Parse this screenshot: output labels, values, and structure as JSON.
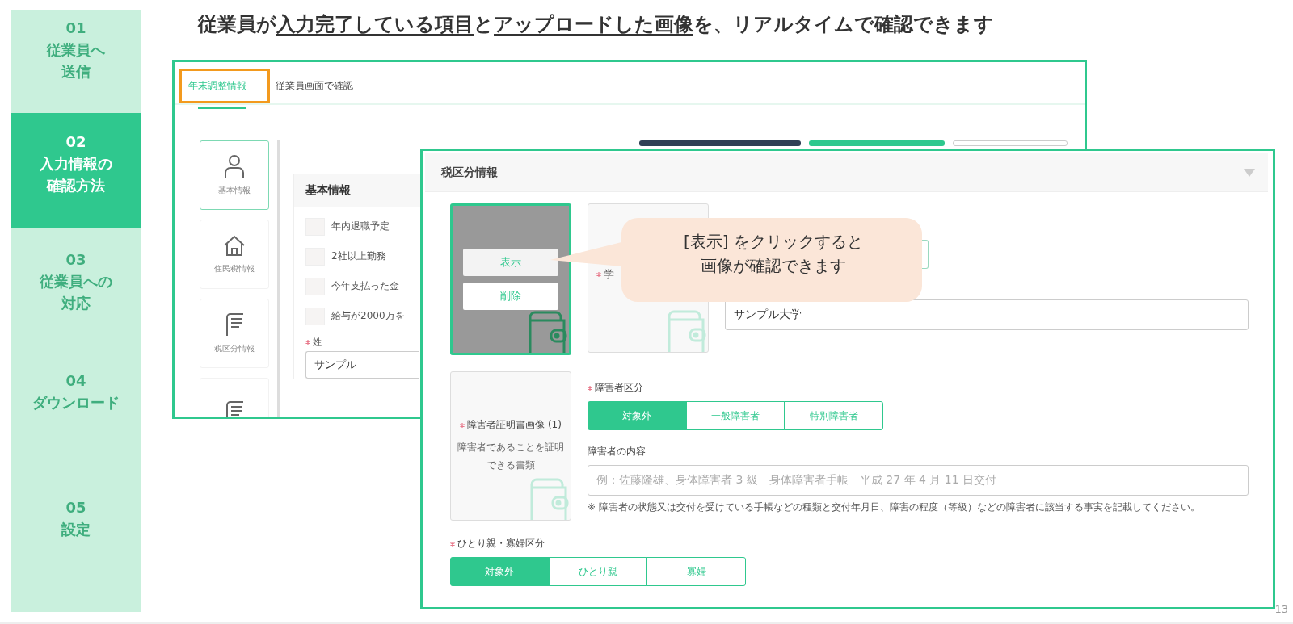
{
  "sidebar": {
    "steps": [
      {
        "number": "01",
        "lines": [
          "従業員へ",
          "送信"
        ],
        "selected": false
      },
      {
        "number": "02",
        "lines": [
          "入力情報の",
          "確認方法"
        ],
        "selected": true
      },
      {
        "number": "03",
        "lines": [
          "従業員への",
          "対応"
        ],
        "selected": false
      },
      {
        "number": "04",
        "lines": [
          "ダウンロード"
        ],
        "selected": false
      },
      {
        "number": "05",
        "lines": [
          "設定"
        ],
        "selected": false
      }
    ]
  },
  "headline": {
    "segments": [
      {
        "text": "従業員が",
        "underlined": false
      },
      {
        "text": "入力完了している項目",
        "underlined": true
      },
      {
        "text": "と",
        "underlined": false
      },
      {
        "text": "アップロードした画像",
        "underlined": true
      },
      {
        "text": "を、リアルタイムで確認できます",
        "underlined": false
      }
    ]
  },
  "screen_1": {
    "tabs": [
      {
        "label": "年末調整情報",
        "selected": true,
        "highlighted": true
      },
      {
        "label": "従業員画面で確認",
        "selected": false,
        "highlighted": false
      }
    ],
    "nav": [
      {
        "kind": "person",
        "label": "基本情報",
        "selected": true
      },
      {
        "kind": "house",
        "label": "住民税情報",
        "selected": false
      },
      {
        "kind": "document",
        "label": "税区分情報",
        "selected": false
      },
      {
        "kind": "document",
        "selected": false
      }
    ],
    "panel": {
      "title": "基本情報",
      "checkboxes": [
        {
          "label": "年内退職予定",
          "checked": false
        },
        {
          "label": "2社以上勤務",
          "checked": false
        },
        {
          "label": "今年支払った金",
          "checked": false
        },
        {
          "label": "給与が2000万を",
          "checked": false
        }
      ],
      "field": {
        "label": "姓",
        "required": true,
        "value": "サンプル"
      }
    }
  },
  "screen_2": {
    "title": "税区分情報",
    "upload_1": {
      "buttons": [
        "表示",
        "削除"
      ]
    },
    "upload_2": {
      "label": "学",
      "required": true
    },
    "school_field": {
      "value": "サンプル大学"
    },
    "upload_3": {
      "label": "障害者証明書画像 (1)",
      "required": true,
      "description": "障害者であることを証明できる書類"
    },
    "disability_type": {
      "label": "障害者区分",
      "required": true,
      "options": [
        {
          "label": "対象外",
          "selected": true
        },
        {
          "label": "一般障害者",
          "selected": false
        },
        {
          "label": "特別障害者",
          "selected": false
        }
      ]
    },
    "disability_details": {
      "label": "障害者の内容",
      "placeholder": "例：佐藤隆雄、身体障害者 3 級　身体障害者手帳　平成 27 年 4 月 11 日交付",
      "note": "※ 障害者の状態又は交付を受けている手帳などの種類と交付年月日、障害の程度（等級）などの障害者に該当する事実を記載してください。"
    },
    "single_parent": {
      "label": "ひとり親・寡婦区分",
      "required": true,
      "options": [
        {
          "label": "対象外",
          "selected": true
        },
        {
          "label": "ひとり親",
          "selected": false
        },
        {
          "label": "寡婦",
          "selected": false
        }
      ]
    }
  },
  "callout": {
    "lines": [
      "[表示] をクリックすると",
      "画像が確認できます"
    ]
  },
  "page_number": "13"
}
